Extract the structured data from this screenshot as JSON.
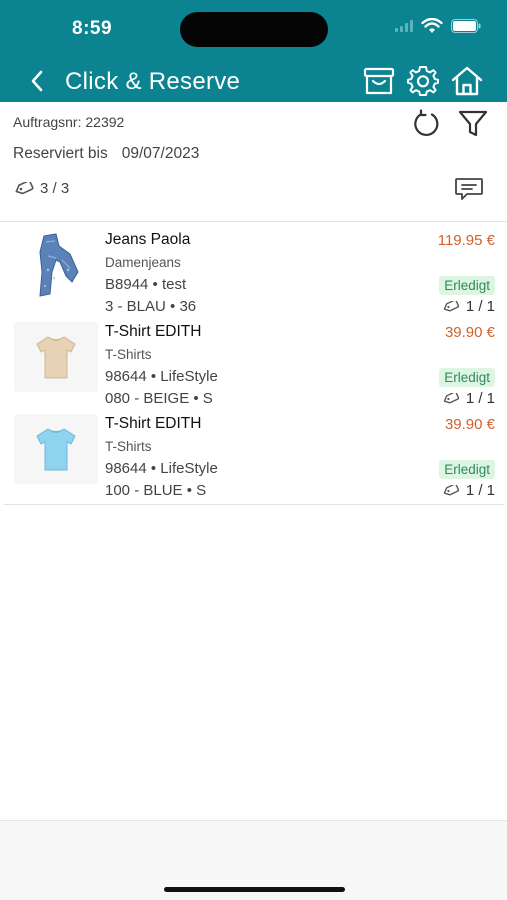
{
  "status_bar": {
    "time": "8:59"
  },
  "header": {
    "title": "Click & Reserve",
    "background": "#0b8390",
    "icons": [
      "basket-icon",
      "settings-icon",
      "home-icon"
    ]
  },
  "order": {
    "number_label": "Auftragsnr: 22392",
    "reserved_label": "Reserviert bis",
    "reserved_date": "09/07/2023",
    "tag_count": "3 / 3"
  },
  "items": [
    {
      "name": "Jeans Paola",
      "category": "Damenjeans",
      "article": "B8944 • test",
      "variant": "3 - BLAU • 36",
      "price": "119.95 €",
      "status": "Erledigt",
      "qty": "1 / 1",
      "image": "jeans-image"
    },
    {
      "name": "T-Shirt EDITH",
      "category": "T-Shirts",
      "article": "98644 • LifeStyle",
      "variant": "080 - BEIGE • S",
      "price": "39.90 €",
      "status": "Erledigt",
      "qty": "1 / 1",
      "image": "tshirt-beige-image"
    },
    {
      "name": "T-Shirt EDITH",
      "category": "T-Shirts",
      "article": "98644 • LifeStyle",
      "variant": "100 - BLUE • S",
      "price": "39.90 €",
      "status": "Erledigt",
      "qty": "1 / 1",
      "image": "tshirt-blue-image"
    }
  ],
  "colors": {
    "price": "#d0622a",
    "status_text": "#2e8b57",
    "status_bg": "#def5e3"
  }
}
